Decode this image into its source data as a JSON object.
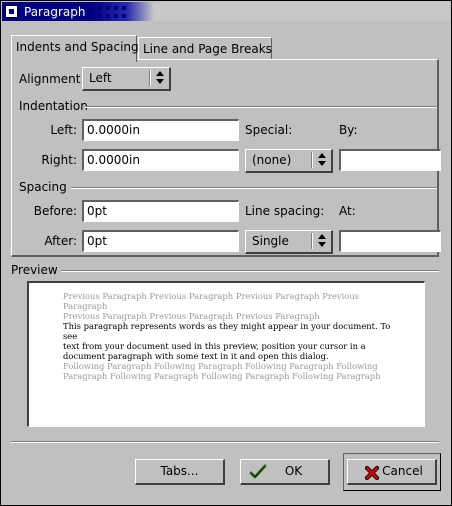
{
  "window": {
    "title": "Paragraph"
  },
  "tabs": [
    {
      "label": "Indents and Spacing",
      "active": true
    },
    {
      "label": "Line and Page Breaks",
      "active": false
    }
  ],
  "alignment": {
    "label": "Alignment:",
    "value": "Left"
  },
  "indentation": {
    "heading": "Indentation",
    "left_label": "Left:",
    "left_value": "0.0000in",
    "right_label": "Right:",
    "right_value": "0.0000in",
    "special_label": "Special:",
    "special_value": "(none)",
    "by_label": "By:",
    "by_value": ""
  },
  "spacing": {
    "heading": "Spacing",
    "before_label": "Before:",
    "before_value": "0pt",
    "after_label": "After:",
    "after_value": "0pt",
    "line_spacing_label": "Line spacing:",
    "line_spacing_value": "Single",
    "at_label": "At:",
    "at_value": ""
  },
  "preview": {
    "heading": "Preview",
    "previous_lines": [
      "Previous Paragraph Previous Paragraph Previous Paragraph Previous Paragraph",
      "Previous Paragraph Previous Paragraph Previous Paragraph"
    ],
    "current_lines": [
      "This paragraph represents words as they might appear in your document.  To see",
      "text from your document used in this preview, position your cursor in a",
      "document paragraph with some text in it and open this dialog."
    ],
    "following_lines": [
      "Following Paragraph Following Paragraph Following Paragraph Following",
      "Paragraph Following Paragraph Following Paragraph Following Paragraph"
    ]
  },
  "buttons": {
    "tabs_label": "Tabs...",
    "ok_label": "OK",
    "cancel_label": "Cancel"
  },
  "icons": {
    "ok": "check-hand-icon",
    "cancel": "red-x-icon"
  },
  "colors": {
    "titlebar": "#000080",
    "dialog_bg": "#c0c0c0",
    "preview_grey_text": "#9a9a9a",
    "cancel_icon": "#d00000",
    "ok_icon": "#3a7a20"
  }
}
